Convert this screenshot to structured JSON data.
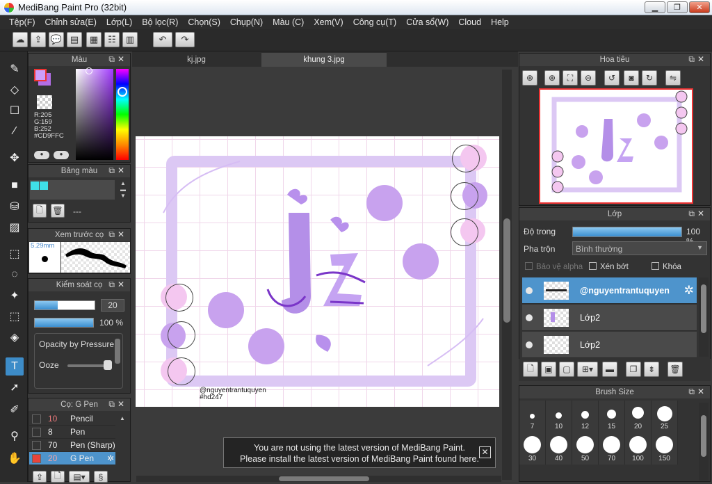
{
  "window": {
    "title": "MediBang Paint Pro (32bit)",
    "minimize": "▁",
    "maximize": "❐",
    "close": "✕"
  },
  "menu": [
    "Tệp(F)",
    "Chỉnh sửa(E)",
    "Lớp(L)",
    "Bộ lọc(R)",
    "Chọn(S)",
    "Chụp(N)",
    "Màu (C)",
    "Xem(V)",
    "Công cụ(T)",
    "Cửa sổ(W)",
    "Cloud",
    "Help"
  ],
  "color_panel": {
    "title": "Màu",
    "r": "R:205",
    "g": "G:159",
    "b": "B:252",
    "hex": "#CD9FFC",
    "main_color": "#cd9ffc",
    "sub_color": "#b36ee6"
  },
  "palette_panel": {
    "title": "Bảng màu",
    "empty_label": "---",
    "swatches": [
      "#3fe0e8",
      "#3fe0e8"
    ]
  },
  "preview_panel": {
    "title": "Xem trước cọ",
    "size": "5.29mm"
  },
  "brush_control": {
    "title": "Kiểm soát cọ",
    "size_value": "20",
    "opacity_value": "100 %",
    "opacity_pressure": "Opacity by Pressure",
    "ooze": "Ooze"
  },
  "brush_list": {
    "title": "Cọ: G Pen",
    "items": [
      {
        "size": "10",
        "name": "Pencil",
        "swatch": "#3a3a3a"
      },
      {
        "size": "8",
        "name": "Pen",
        "swatch": "#3a3a3a"
      },
      {
        "size": "70",
        "name": "Pen (Sharp)",
        "swatch": "#3a3a3a"
      },
      {
        "size": "20",
        "name": "G Pen",
        "swatch": "#e8443c"
      }
    ]
  },
  "tabs": [
    "kj.jpg",
    "khung 3.jpg"
  ],
  "artwork": {
    "signature": "@nguyentrantuquyen",
    "tag": "#hd247"
  },
  "notice": {
    "line1": "You are not using the latest version of MediBang Paint.",
    "line2": "Please install the latest version of MediBang Paint found here.",
    "close": "✕"
  },
  "navigator": {
    "title": "Hoa tiêu"
  },
  "layer_panel": {
    "title": "Lớp",
    "opacity_label": "Độ trong",
    "opacity_value": "100 %",
    "blend_label": "Pha trộn",
    "blend_value": "Bình thường",
    "protect_alpha": "Bảo vệ alpha",
    "clip": "Xén bớt",
    "lock": "Khóa",
    "layers": [
      {
        "name": "@nguyentrantuquyen",
        "selected": true
      },
      {
        "name": "Lớp2",
        "selected": false
      },
      {
        "name": "Lớp2",
        "selected": false
      }
    ]
  },
  "brush_size": {
    "title": "Brush Size",
    "sizes": [
      "7",
      "10",
      "12",
      "15",
      "20",
      "25",
      "30",
      "40",
      "50",
      "70",
      "100",
      "150"
    ]
  }
}
